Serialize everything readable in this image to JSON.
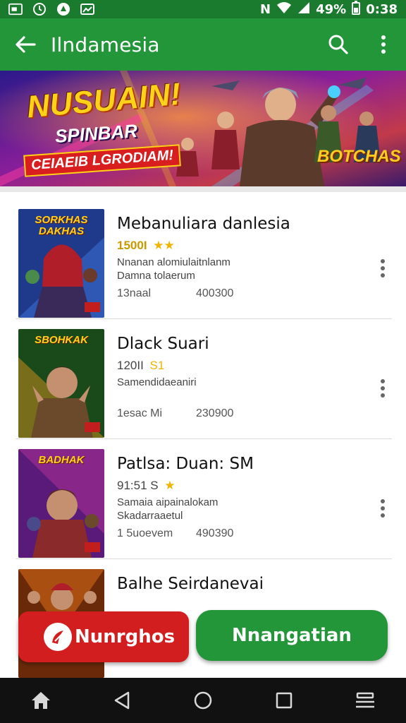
{
  "status_bar": {
    "carrier_glyph": "N",
    "battery_percent": "49%",
    "time": "0:38",
    "icons": [
      "notification-box-icon",
      "clock-icon",
      "app-icon",
      "gallery-icon",
      "wifi-icon",
      "signal-icon",
      "battery-icon"
    ]
  },
  "app_bar": {
    "title": "Ilndamesia",
    "icons": [
      "back-arrow-icon",
      "search-icon",
      "more-vert-icon"
    ]
  },
  "banner": {
    "title": "NUSUAIN!",
    "subtitle": "SPINBAR",
    "tagline": "CEIAEIB LGRODIAM!",
    "logo": "BOTCHAS"
  },
  "list": {
    "items": [
      {
        "thumb_label": "SORKHAS DAKHAS",
        "title": "Mebanuliara danlesia",
        "rating": "1500I",
        "stars": "★★",
        "desc_line1": "Nnanan alomiulaitnlanm",
        "desc_line2": "Damna tolaerum",
        "meta_a": "13naal",
        "meta_b": "400300"
      },
      {
        "thumb_label": "SBOHKAK",
        "title": "Dlack Suari",
        "rating": "120II",
        "stars": "S1",
        "desc_line1": "Samendidaeaniri",
        "desc_line2": "",
        "meta_a": "1esac Mi",
        "meta_b": "230900"
      },
      {
        "thumb_label": "BADHAK",
        "title": "Patlsa: Duan: SM",
        "rating": "91:51 S",
        "stars": "★",
        "desc_line1": "Samaia aipainalokam",
        "desc_line2": "Skadarraaetul",
        "meta_a": "1 5uoevem",
        "meta_b": "490390"
      },
      {
        "thumb_label": "",
        "title": "Balhe Seirdanevai",
        "rating": "",
        "stars": "",
        "desc_line1": "",
        "desc_line2": "",
        "meta_a": "",
        "meta_b": ""
      }
    ]
  },
  "buttons": {
    "left_label": "Nunrghos",
    "right_label": "Nnangatian"
  },
  "nav_bar": {
    "icons": [
      "home-icon",
      "back-nav-icon",
      "home-circle-icon",
      "recents-icon",
      "menu-icon"
    ]
  },
  "colors": {
    "status_green": "#1a7a2e",
    "app_green": "#23963a",
    "red_button": "#d21e1e",
    "star_gold": "#f0b400"
  }
}
